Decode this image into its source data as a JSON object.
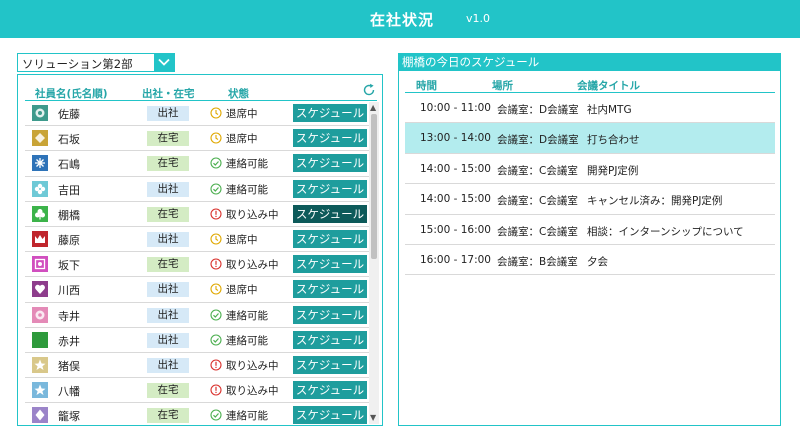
{
  "header": {
    "title": "在社状況",
    "version": "v1.0"
  },
  "department": {
    "selected": "ソリューション第2部"
  },
  "employees": {
    "columns": {
      "name": "社員名(氏名順)",
      "location": "出社・在宅",
      "status": "状態"
    },
    "rows": [
      {
        "name": "佐藤",
        "location": "出社",
        "loc_type": "office",
        "status": "退席中",
        "status_type": "away",
        "button": "スケジュール",
        "active": false,
        "avatar_color": "#3e9a8c",
        "avatar_icon": "gear-icon"
      },
      {
        "name": "石坂",
        "location": "在宅",
        "loc_type": "home",
        "status": "退席中",
        "status_type": "away",
        "button": "スケジュール",
        "active": false,
        "avatar_color": "#c9a437",
        "avatar_icon": "ornament-icon"
      },
      {
        "name": "石嶋",
        "location": "在宅",
        "loc_type": "home",
        "status": "連絡可能",
        "status_type": "ok",
        "button": "スケジュール",
        "active": false,
        "avatar_color": "#2e73b8",
        "avatar_icon": "snowflake-icon"
      },
      {
        "name": "吉田",
        "location": "出社",
        "loc_type": "office",
        "status": "連絡可能",
        "status_type": "ok",
        "button": "スケジュール",
        "active": false,
        "avatar_color": "#6ec9d6",
        "avatar_icon": "flower-icon"
      },
      {
        "name": "棚橋",
        "location": "在宅",
        "loc_type": "home",
        "status": "取り込み中",
        "status_type": "busy",
        "button": "スケジュール",
        "active": true,
        "avatar_color": "#3cb34a",
        "avatar_icon": "clover-icon"
      },
      {
        "name": "藤原",
        "location": "出社",
        "loc_type": "office",
        "status": "退席中",
        "status_type": "away",
        "button": "スケジュール",
        "active": false,
        "avatar_color": "#c0262d",
        "avatar_icon": "crown-icon"
      },
      {
        "name": "坂下",
        "location": "在宅",
        "loc_type": "home",
        "status": "取り込み中",
        "status_type": "busy",
        "button": "スケジュール",
        "active": false,
        "avatar_color": "#d14fbf",
        "avatar_icon": "frame-icon"
      },
      {
        "name": "川西",
        "location": "出社",
        "loc_type": "office",
        "status": "退席中",
        "status_type": "away",
        "button": "スケジュール",
        "active": false,
        "avatar_color": "#8e3d8c",
        "avatar_icon": "heart-icon"
      },
      {
        "name": "寺井",
        "location": "出社",
        "loc_type": "office",
        "status": "連絡可能",
        "status_type": "ok",
        "button": "スケジュール",
        "active": false,
        "avatar_color": "#e48ab7",
        "avatar_icon": "blossom-icon"
      },
      {
        "name": "赤井",
        "location": "出社",
        "loc_type": "office",
        "status": "連絡可能",
        "status_type": "ok",
        "button": "スケジュール",
        "active": false,
        "avatar_color": "#2e9a3c",
        "avatar_icon": "leaf-icon"
      },
      {
        "name": "猪俣",
        "location": "出社",
        "loc_type": "office",
        "status": "取り込み中",
        "status_type": "busy",
        "button": "スケジュール",
        "active": false,
        "avatar_color": "#d9c88a",
        "avatar_icon": "star-icon"
      },
      {
        "name": "八幡",
        "location": "在宅",
        "loc_type": "home",
        "status": "取り込み中",
        "status_type": "busy",
        "button": "スケジュール",
        "active": false,
        "avatar_color": "#7ab8dc",
        "avatar_icon": "star-icon"
      },
      {
        "name": "籠塚",
        "location": "在宅",
        "loc_type": "home",
        "status": "連絡可能",
        "status_type": "ok",
        "button": "スケジュール",
        "active": false,
        "avatar_color": "#9b84c9",
        "avatar_icon": "diamond-icon"
      }
    ]
  },
  "schedule": {
    "title": "棚橋の今日のスケジュール",
    "columns": {
      "time": "時間",
      "place": "場所",
      "meeting": "会議タイトル"
    },
    "rows": [
      {
        "time": "10:00 - 11:00",
        "place": "会議室：D会議室",
        "meeting": "社内MTG",
        "highlight": false
      },
      {
        "time": "13:00 - 14:00",
        "place": "会議室：D会議室",
        "meeting": "打ち合わせ",
        "highlight": true
      },
      {
        "time": "14:00 - 15:00",
        "place": "会議室：C会議室",
        "meeting": "開発PJ定例",
        "highlight": false
      },
      {
        "time": "14:00 - 15:00",
        "place": "会議室：C会議室",
        "meeting": "キャンセル済み：開発PJ定例",
        "highlight": false
      },
      {
        "time": "15:00 - 16:00",
        "place": "会議室：C会議室",
        "meeting": "相談：インターンシップについて",
        "highlight": false
      },
      {
        "time": "16:00 - 17:00",
        "place": "会議室：B会議室",
        "meeting": "夕会",
        "highlight": false
      }
    ]
  },
  "colors": {
    "accent": "#22c4c8",
    "button": "#1e9d9d",
    "button_active": "#0d5a5a",
    "status_away": "#e0a800",
    "status_ok": "#4caf50",
    "status_busy": "#d9302c",
    "highlight_row": "#b3ecee"
  }
}
